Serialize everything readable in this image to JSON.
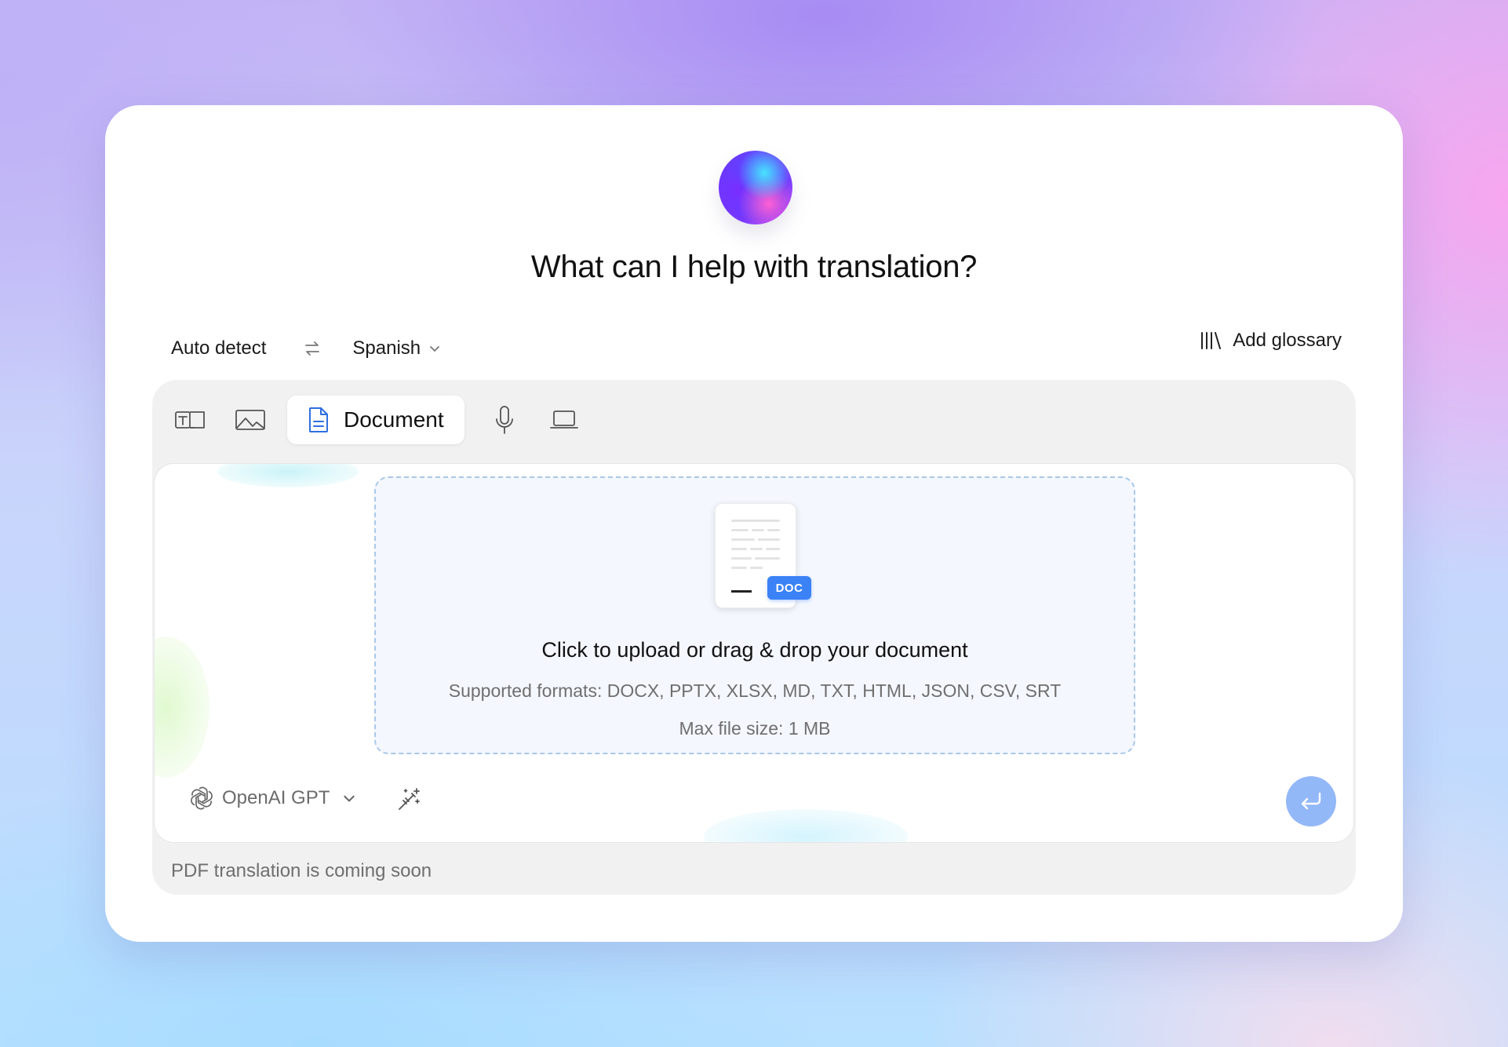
{
  "header": {
    "title": "What can I help with translation?"
  },
  "languages": {
    "source": "Auto detect",
    "target": "Spanish",
    "swap_icon": "swap-arrows-icon"
  },
  "glossary": {
    "label": "Add glossary",
    "icon": "library-icon"
  },
  "tabs": [
    {
      "name": "text",
      "icon": "text-translate-icon"
    },
    {
      "name": "image",
      "icon": "image-icon"
    },
    {
      "name": "document",
      "icon": "document-icon",
      "label": "Document",
      "active": true
    },
    {
      "name": "voice",
      "icon": "microphone-icon"
    },
    {
      "name": "website",
      "icon": "laptop-icon"
    }
  ],
  "upload": {
    "badge": "DOC",
    "title": "Click to upload or drag & drop your document",
    "formats": "Supported formats: DOCX, PPTX, XLSX, MD, TXT, HTML, JSON, CSV, SRT",
    "max_size": "Max file size: 1 MB"
  },
  "model": {
    "label": "OpenAI GPT",
    "icon": "openai-icon"
  },
  "footer": {
    "note": "PDF translation is coming soon"
  },
  "colors": {
    "accent": "#3b82f6",
    "send_button": "#93b8f8",
    "dropzone_border": "#a9c9ea",
    "dropzone_bg": "#f4f7fe"
  }
}
